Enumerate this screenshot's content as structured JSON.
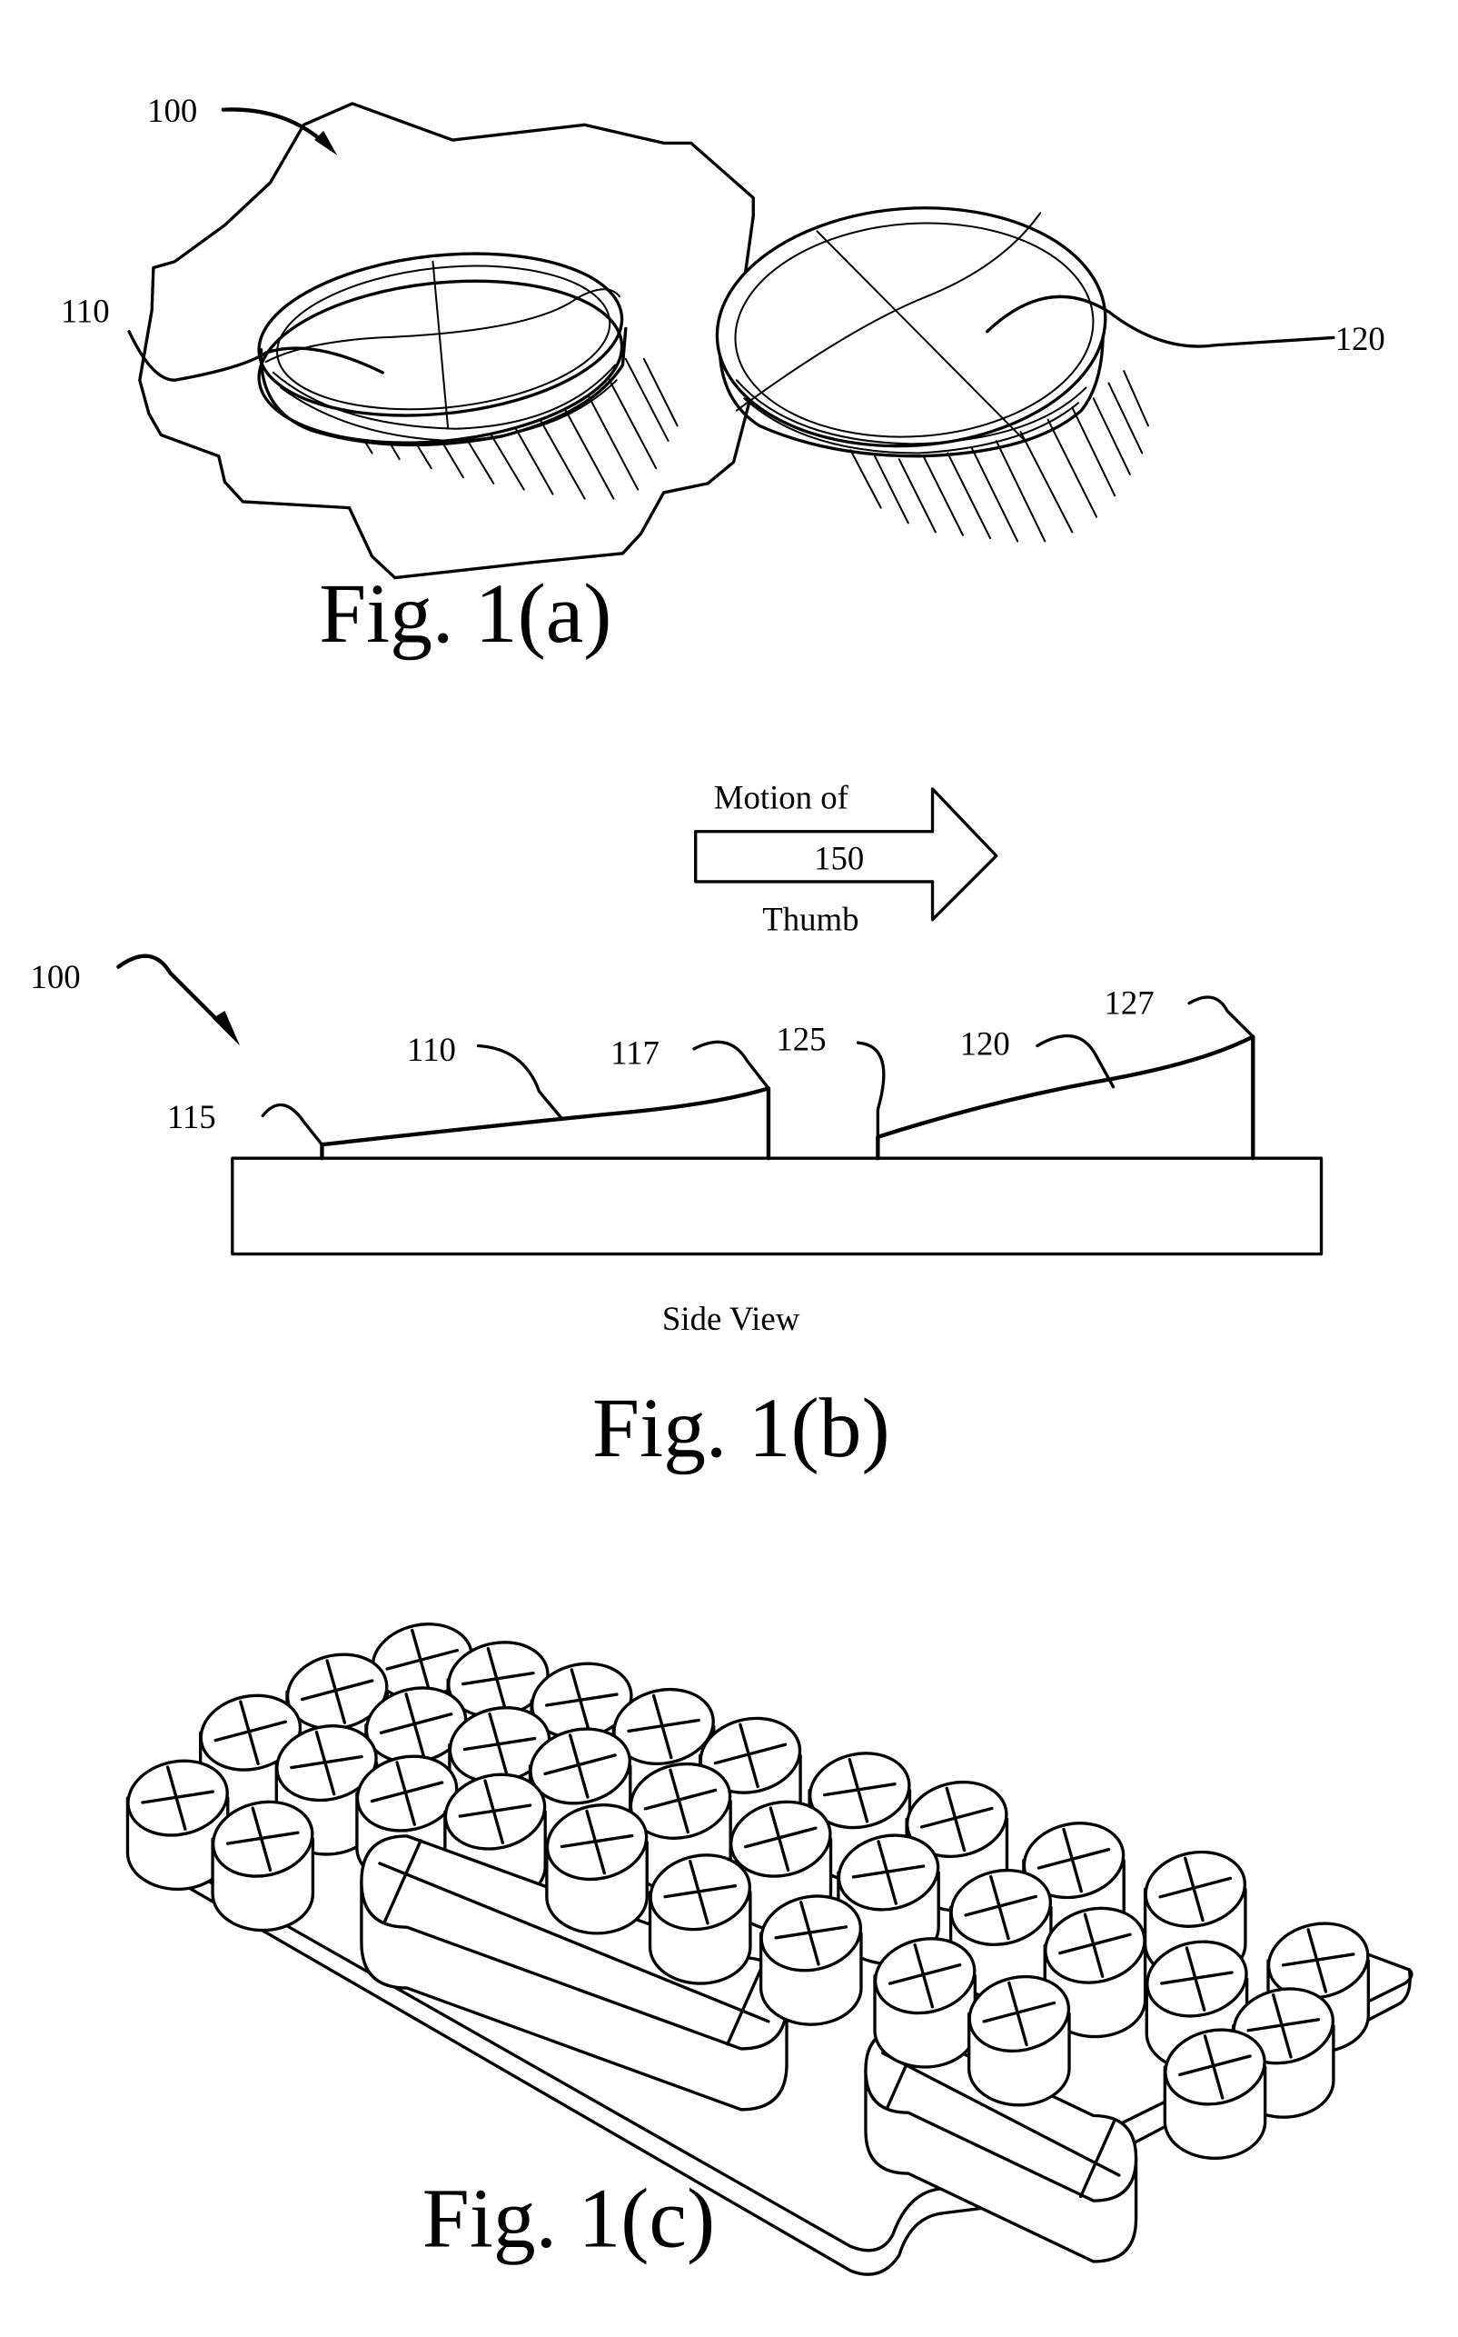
{
  "figures": {
    "fig1a": {
      "caption": "Fig. 1(a)",
      "labels": {
        "assembly": "100",
        "first_key": "110",
        "second_key": "120"
      }
    },
    "fig1b": {
      "caption": "Fig. 1(b)",
      "view_label": "Side View",
      "arrow": {
        "line1": "Motion of",
        "ref": "150",
        "line2": "Thumb"
      },
      "labels": {
        "assembly": "100",
        "first_key": "110",
        "leading_edge": "115",
        "trailing_edge": "117",
        "second_key": "120",
        "gap": "125",
        "second_trailing_edge": "127"
      }
    },
    "fig1c": {
      "caption": "Fig. 1(c)"
    }
  },
  "colors": {
    "ink": "#000000",
    "paper": "#ffffff"
  }
}
